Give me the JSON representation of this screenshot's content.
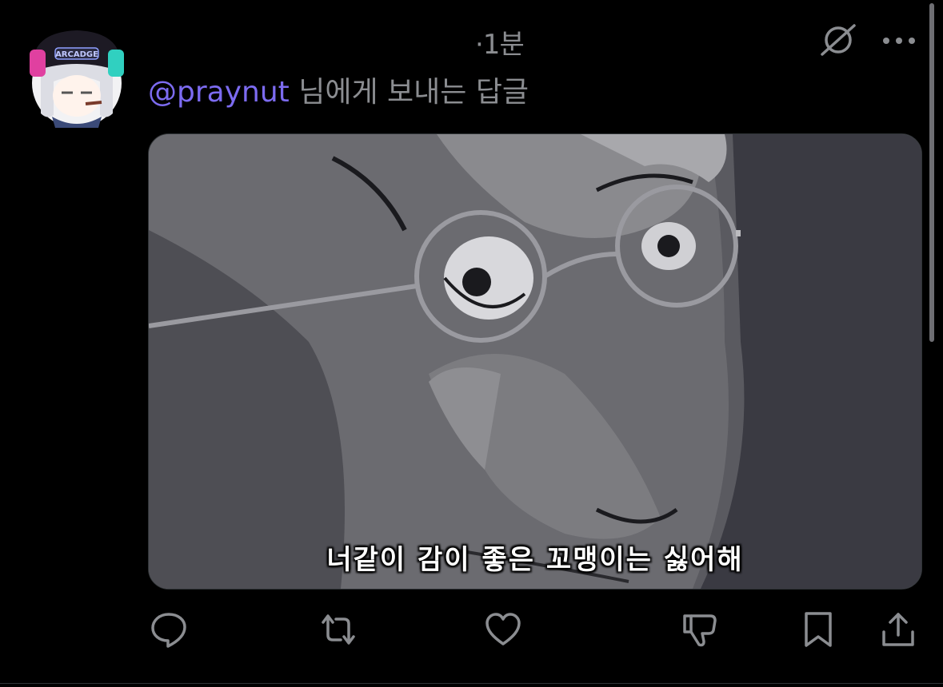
{
  "tweet": {
    "timestamp": "·1분",
    "reply_mention": "@praynut",
    "reply_suffix": " 님에게 보내는 답글",
    "media": {
      "subtitle": "너같이 감이 좋은 꼬맹이는 싫어해"
    }
  },
  "avatar": {
    "cap_text": "ARCADGE"
  },
  "icons": {
    "grok": "grok-icon",
    "more": "more-icon",
    "reply": "reply-icon",
    "repost": "repost-icon",
    "like": "heart-icon",
    "dislike": "thumbs-down-icon",
    "bookmark": "bookmark-icon",
    "share": "share-icon"
  },
  "colors": {
    "background": "#000000",
    "mention": "#7c6bf0",
    "muted_text": "#8b8d91",
    "action_icon": "#8b8d91"
  }
}
